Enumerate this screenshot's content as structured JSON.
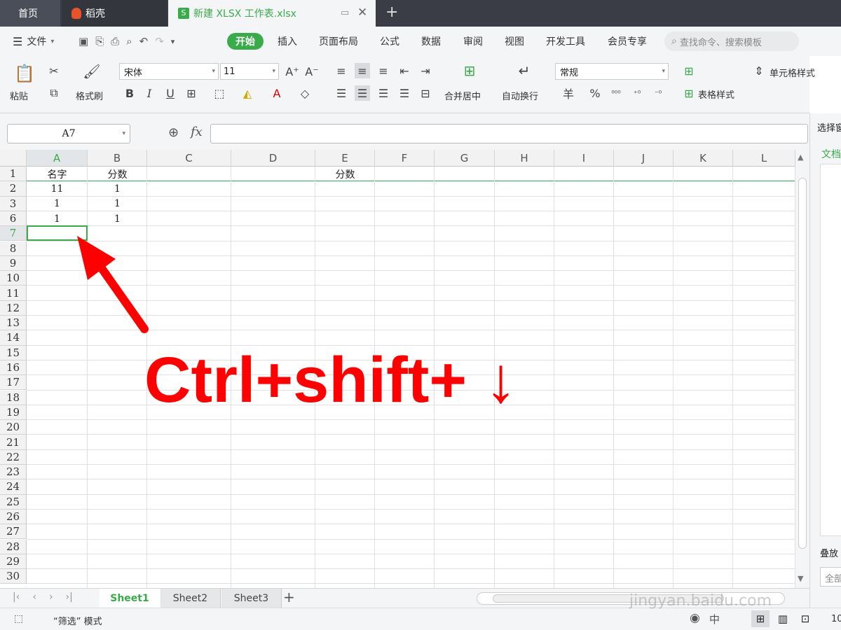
{
  "tabs": [
    {
      "label": "首页"
    },
    {
      "label": "稻壳"
    },
    {
      "label": "新建 XLSX 工作表.xlsx"
    }
  ],
  "menu": {
    "file": "文件",
    "items": [
      "开始",
      "插入",
      "页面布局",
      "公式",
      "数据",
      "审阅",
      "视图",
      "开发工具",
      "会员专享"
    ],
    "search_placeholder": "查找命令、搜索模板"
  },
  "ribbon": {
    "paste": "粘贴",
    "format_painter": "格式刷",
    "font_name": "宋体",
    "font_size": "11",
    "merge_center": "合并居中",
    "wrap_text": "自动换行",
    "number_format": "常规",
    "cell_style": "单元格样式",
    "table_style": "表格样式",
    "currency": "羊",
    "percent": "%"
  },
  "formula_bar": {
    "name_box": "A7",
    "fx": "fx",
    "formula": ""
  },
  "sheet": {
    "columns": [
      "A",
      "B",
      "C",
      "D",
      "E",
      "F",
      "G",
      "H",
      "I",
      "J",
      "K",
      "L"
    ],
    "rows": [
      "1",
      "2",
      "3",
      "6",
      "7",
      "8",
      "9",
      "10",
      "11",
      "12",
      "13",
      "14",
      "15",
      "16",
      "17",
      "18",
      "19",
      "20",
      "21",
      "22",
      "23",
      "24",
      "25",
      "26",
      "27",
      "28",
      "29",
      "30"
    ],
    "cells": {
      "A1": "名字",
      "B1": "分数",
      "E1": "分数",
      "A2": "11",
      "B2": "1",
      "A3": "1",
      "B3": "1",
      "A6": "1",
      "B6": "1"
    },
    "selected": "A7"
  },
  "annotation": {
    "text": "Ctrl+shift+ ↓",
    "color": "#ff0000"
  },
  "sheet_tabs": [
    "Sheet1",
    "Sheet2",
    "Sheet3"
  ],
  "sidepanel": {
    "title": "选择窗",
    "doc_label": "文档",
    "stack_label": "叠放",
    "all_label": "全部"
  },
  "status": {
    "mode_text": "“筛选” 模式",
    "zoom": "10"
  },
  "watermark": {
    "text": "jingyan.baidu.com"
  },
  "colors": {
    "accent": "#3aab4a",
    "tabbar": "#3a3d45",
    "arrow": "#ff0000"
  }
}
